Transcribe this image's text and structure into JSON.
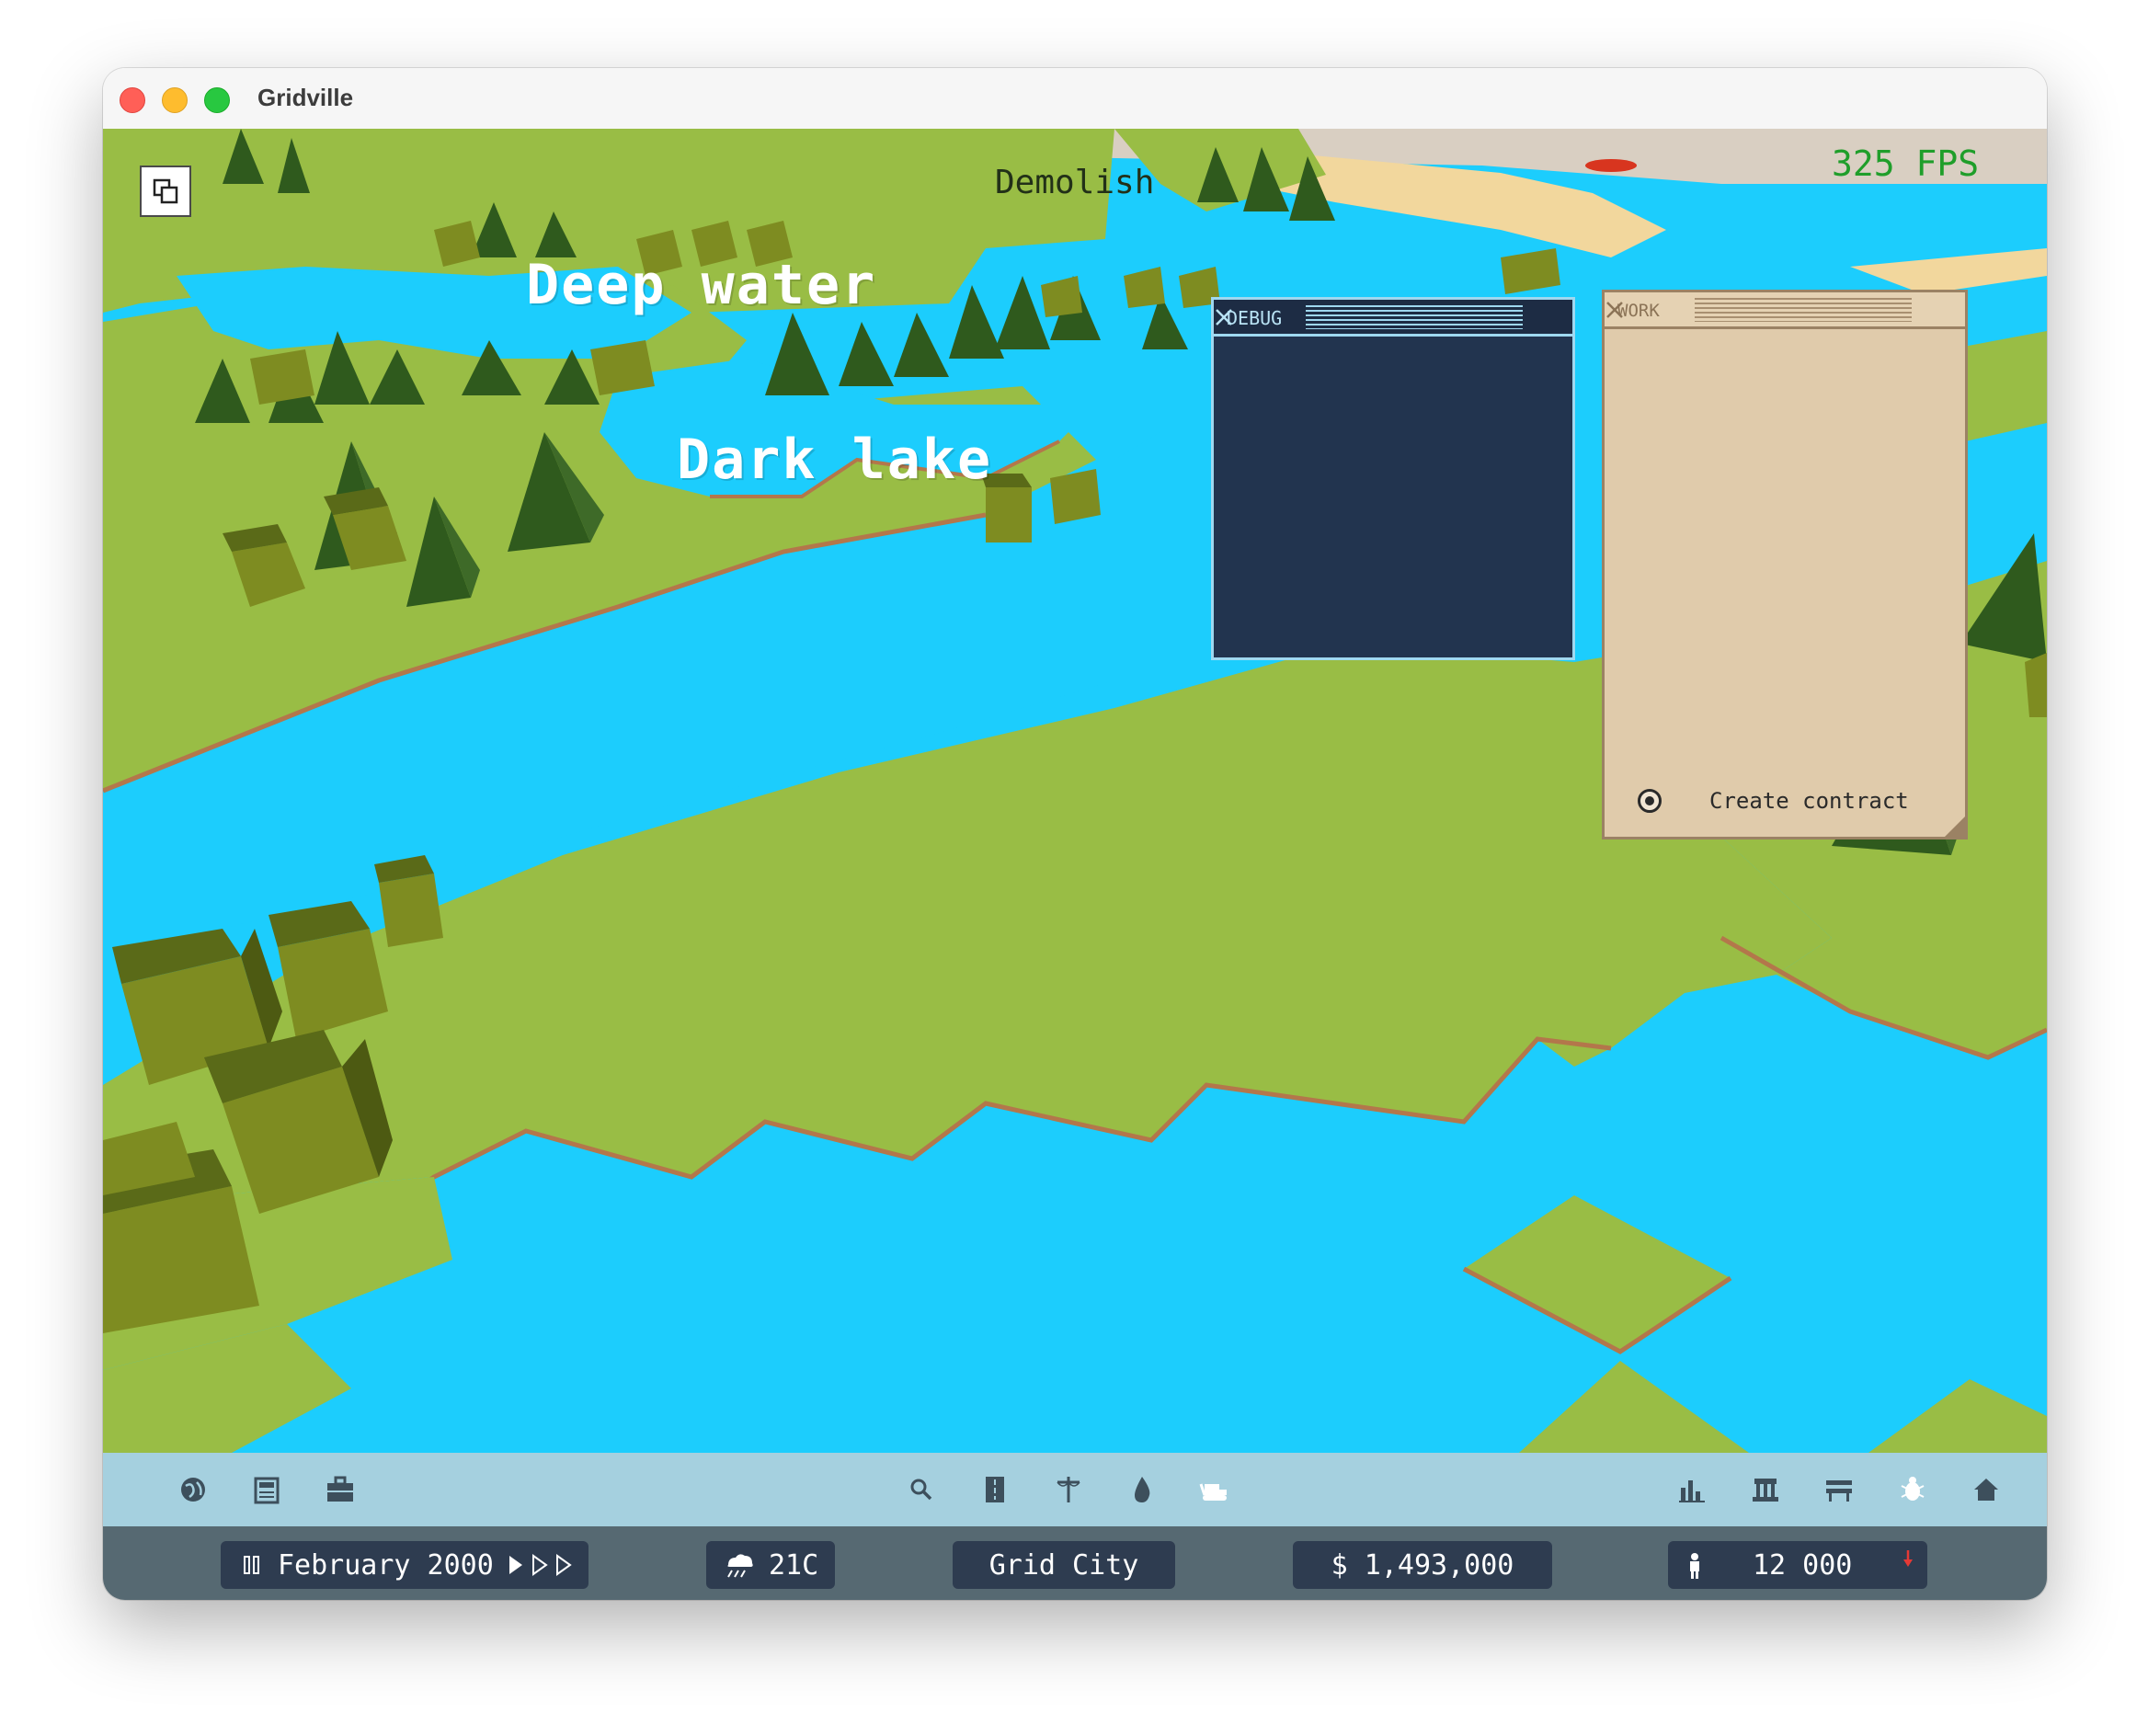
{
  "window": {
    "title": "Gridville"
  },
  "hud": {
    "fps": "325 FPS",
    "layers_icon": "layers-icon"
  },
  "map_labels": {
    "deep_water": "Deep water",
    "dark_lake": "Dark lake",
    "demolish": "Demolish"
  },
  "debug_panel": {
    "title": "DEBUG",
    "close_icon": "close-icon"
  },
  "work_panel": {
    "title": "WORK",
    "close_icon": "close-icon",
    "option_label": "Create contract",
    "option_selected": true
  },
  "toolbar": {
    "left": [
      "globe-icon",
      "newspaper-icon",
      "briefcase-icon"
    ],
    "center": [
      "magnifier-icon",
      "road-icon",
      "power-line-icon",
      "water-drop-icon",
      "bulldozer-icon"
    ],
    "right": [
      "bar-chart-icon",
      "bank-icon",
      "bench-icon",
      "bug-icon",
      "home-icon"
    ]
  },
  "status": {
    "date": "February 2000",
    "temperature": "21C",
    "city_name": "Grid City",
    "money": "$ 1,493,000",
    "population": "12 000",
    "population_trend": "down"
  },
  "colors": {
    "water": "#1ccdfd",
    "grass": "#99bd45",
    "toolbar": "#a5d0df",
    "statusbar": "#566972",
    "pill": "#2e3c50",
    "fps": "#1f9e2a",
    "debug_bg": "#22344f",
    "work_bg": "#e0cbab"
  }
}
